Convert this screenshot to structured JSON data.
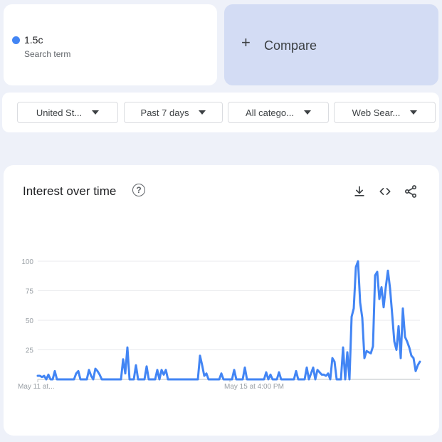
{
  "term": {
    "name": "1.5c",
    "subtitle": "Search term",
    "color": "#4285f4"
  },
  "compare": {
    "label": "Compare",
    "icon": "plus-icon"
  },
  "filters": [
    {
      "label": "United St...",
      "icon": "caret-down-icon"
    },
    {
      "label": "Past 7 days",
      "icon": "caret-down-icon"
    },
    {
      "label": "All catego...",
      "icon": "caret-down-icon"
    },
    {
      "label": "Web Sear...",
      "icon": "caret-down-icon"
    }
  ],
  "chart_card": {
    "title": "Interest over time",
    "icons": [
      "help-icon",
      "download-icon",
      "embed-code-icon",
      "share-icon"
    ]
  },
  "chart_data": {
    "type": "line",
    "title": "",
    "xlabel": "",
    "ylabel": "",
    "ylim": [
      0,
      100
    ],
    "yticks": [
      "100",
      "75",
      "50",
      "25"
    ],
    "xticks": [
      {
        "label": "May 11 at...",
        "index": 0
      },
      {
        "label": "May 15 at 4:00 PM",
        "index": 90
      }
    ],
    "grid": true,
    "series": [
      {
        "color": "#4285f4",
        "values": [
          3,
          3,
          2,
          3,
          0,
          4,
          0,
          0,
          7,
          0,
          0,
          0,
          0,
          0,
          0,
          0,
          0,
          0,
          5,
          7,
          0,
          0,
          0,
          0,
          8,
          3,
          0,
          9,
          7,
          4,
          0,
          0,
          0,
          0,
          0,
          0,
          0,
          0,
          0,
          0,
          17,
          5,
          27,
          0,
          0,
          0,
          12,
          0,
          0,
          0,
          0,
          11,
          0,
          0,
          0,
          0,
          8,
          0,
          8,
          4,
          8,
          0,
          0,
          0,
          0,
          0,
          0,
          0,
          0,
          0,
          0,
          0,
          0,
          0,
          0,
          0,
          20,
          12,
          3,
          5,
          0,
          0,
          0,
          0,
          0,
          0,
          5,
          0,
          0,
          0,
          0,
          0,
          8,
          0,
          0,
          0,
          0,
          10,
          0,
          0,
          0,
          0,
          0,
          0,
          0,
          0,
          0,
          6,
          0,
          4,
          0,
          0,
          0,
          6,
          0,
          0,
          0,
          0,
          0,
          0,
          0,
          7,
          0,
          0,
          0,
          0,
          10,
          0,
          5,
          10,
          0,
          8,
          6,
          4,
          4,
          3,
          5,
          0,
          18,
          15,
          0,
          0,
          0,
          27,
          0,
          23,
          0,
          53,
          60,
          95,
          100,
          65,
          52,
          18,
          24,
          23,
          22,
          28,
          88,
          91,
          68,
          78,
          61,
          78,
          92,
          77,
          55,
          32,
          25,
          45,
          18,
          60,
          36,
          32,
          27,
          20,
          18,
          7,
          12,
          15
        ]
      }
    ]
  }
}
